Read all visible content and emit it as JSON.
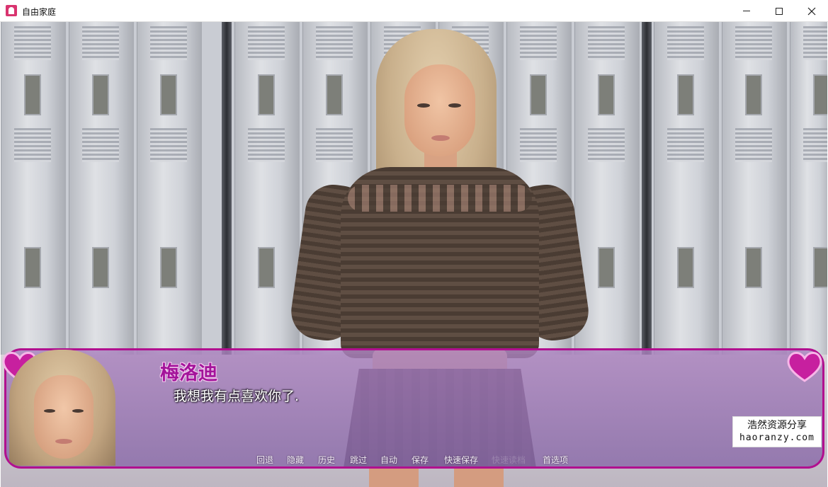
{
  "window": {
    "title": "自由家庭",
    "controls": {
      "minimize": "minimize-icon",
      "maximize": "maximize-icon",
      "close": "close-icon"
    }
  },
  "dialogue": {
    "speaker": "梅洛迪",
    "text": "我想我有点喜欢你了.",
    "speaker_color": "#a3149a",
    "frame_color": "#b1108f"
  },
  "quick_menu": {
    "items": [
      {
        "label": "回退",
        "enabled": true
      },
      {
        "label": "隐藏",
        "enabled": true
      },
      {
        "label": "历史",
        "enabled": true
      },
      {
        "label": "跳过",
        "enabled": true
      },
      {
        "label": "自动",
        "enabled": true
      },
      {
        "label": "保存",
        "enabled": true
      },
      {
        "label": "快速保存",
        "enabled": true
      },
      {
        "label": "快速读档",
        "enabled": false
      },
      {
        "label": "首选项",
        "enabled": true
      }
    ]
  },
  "watermark": {
    "line1": "浩然资源分享",
    "line2": "haoranzy.com"
  }
}
